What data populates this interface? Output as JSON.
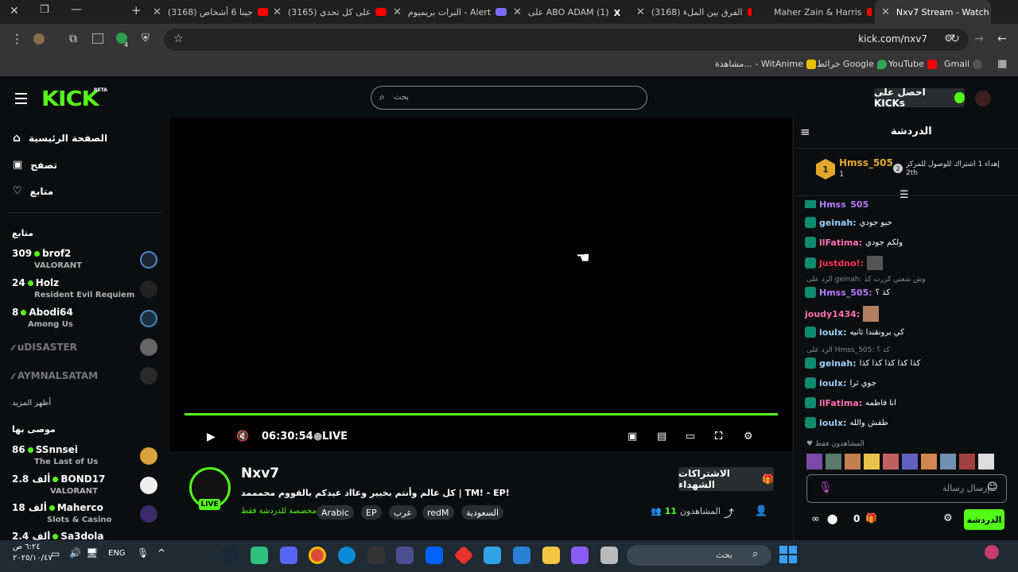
{
  "browser": {
    "tabs": [
      {
        "title": "جينا 6 أشخاص (3168)",
        "active": false
      },
      {
        "title": "على كل تحدي (3165)",
        "active": false
      },
      {
        "title": "البرات بريميوم - Alert",
        "active": false
      },
      {
        "title": "على ABO ADAM (1)",
        "active": false
      },
      {
        "title": "الفرق بين الملء (3168)",
        "active": false
      },
      {
        "title": "Maher Zain & Harris",
        "active": false
      },
      {
        "title": "Nxv7 Stream - Watch",
        "active": true
      }
    ],
    "url": "kick.com/nxv7",
    "extension_badge": "4",
    "bookmarks": [
      "Gmail",
      "YouTube",
      "خرائط Google",
      "مشاهدة... - WitAnime"
    ]
  },
  "site": {
    "logo": "KICK",
    "logo_badge": "BETA",
    "search_placeholder": "بحث",
    "kicks_button": "احصل على KICKs",
    "nav": {
      "home": "الصفحة الرئيسية",
      "browse": "تصفح",
      "following": "متابع"
    },
    "following_heading": "متابع",
    "following_channels": [
      {
        "viewers": "309",
        "name": "brof2",
        "game": "VALORANT",
        "live": true
      },
      {
        "viewers": "24",
        "name": "Holz",
        "game": "Resident Evil Requiem",
        "live": true
      },
      {
        "viewers": "8",
        "name": "Abodi64",
        "game": "Among Us",
        "live": true
      },
      {
        "viewers": "",
        "name": "uDISASTER",
        "game": "",
        "live": false
      },
      {
        "viewers": "",
        "name": "AYMNALSATAM",
        "game": "",
        "live": false
      }
    ],
    "show_more": "أظهر المزيد",
    "recommended_heading": "موصى بها",
    "recommended_channels": [
      {
        "viewers": "86",
        "name": "SSnnsei",
        "game": "The Last of Us"
      },
      {
        "viewers": "2.8 ألف",
        "name": "BOND17",
        "game": "VALORANT"
      },
      {
        "viewers": "18 ألف",
        "name": "Maherco",
        "game": "Slots & Casino"
      },
      {
        "viewers": "2.4 ألف",
        "name": "Sa3dola",
        "game": ""
      }
    ]
  },
  "player": {
    "time": "06:30:54",
    "live_label": "LIVE"
  },
  "stream": {
    "streamer": "Nxv7",
    "live_badge": "LIVE",
    "title": "كل عالم وأنتم بخيير وعااد عيدكم بالقووم محمممد | TM! - EP!",
    "chat_note": "مخصصة للدردشة فقط",
    "tags": [
      "Arabic",
      "EP",
      "عرب",
      "redM",
      "السعودية"
    ],
    "viewers_label": "المشاهدون",
    "viewers_count": "11",
    "subscribe_button": "الاشتراكات الشهداء"
  },
  "chat": {
    "title": "الدردشة",
    "gift_text": "إهداء 1 اشتراك للوصول للمركز",
    "gift_rank": "2th",
    "top_gifter": "Hmss_505",
    "top_gifter_count": "1",
    "messages": [
      {
        "user": "Hmss_505",
        "text": "",
        "color": "#b57bff"
      },
      {
        "user": "geinah:",
        "text": "حيو جودي",
        "color": "#9ad1ff"
      },
      {
        "user": "llFatima:",
        "text": "ولكم جودي",
        "color": "#ff6fb3"
      },
      {
        "user": "justdno!:",
        "text": "",
        "color": "#ff3355"
      },
      {
        "user": "Hmss_505:",
        "text": "كذ ؟",
        "color": "#b57bff"
      },
      {
        "user": "joudy1434:",
        "text": "",
        "color": "#ff6fb3"
      },
      {
        "user": "ioulx:",
        "text": "كي برونقندا ثانيه",
        "color": "#9ad1ff"
      },
      {
        "user": "geinah:",
        "text": "كذا كذا كذا كذا كذا",
        "color": "#9ad1ff"
      },
      {
        "user": "ioulx:",
        "text": "جوي ثرا",
        "color": "#9ad1ff"
      },
      {
        "user": "llFatima:",
        "text": "انا فاطمه",
        "color": "#ff6fb3"
      },
      {
        "user": "ioulx:",
        "text": "طفش والله",
        "color": "#9ad1ff"
      }
    ],
    "reply_1": "الرد على geinah: وش شعني كررت كذ",
    "reply_2": "الرد على Hmss_505: كذ ؟",
    "viewers_note": "المشاهدون فقط",
    "input_placeholder": "إرسال رسالة",
    "kicks_count": "0",
    "send_button": "الدردشة"
  },
  "taskbar": {
    "search_placeholder": "بحث",
    "lang": "ENG",
    "time": "٦:٢٤ ص",
    "date": "٢٠٢٥/١٠/٤٧"
  },
  "colors": {
    "accent": "#53fc18",
    "background": "#0b0e0f"
  }
}
